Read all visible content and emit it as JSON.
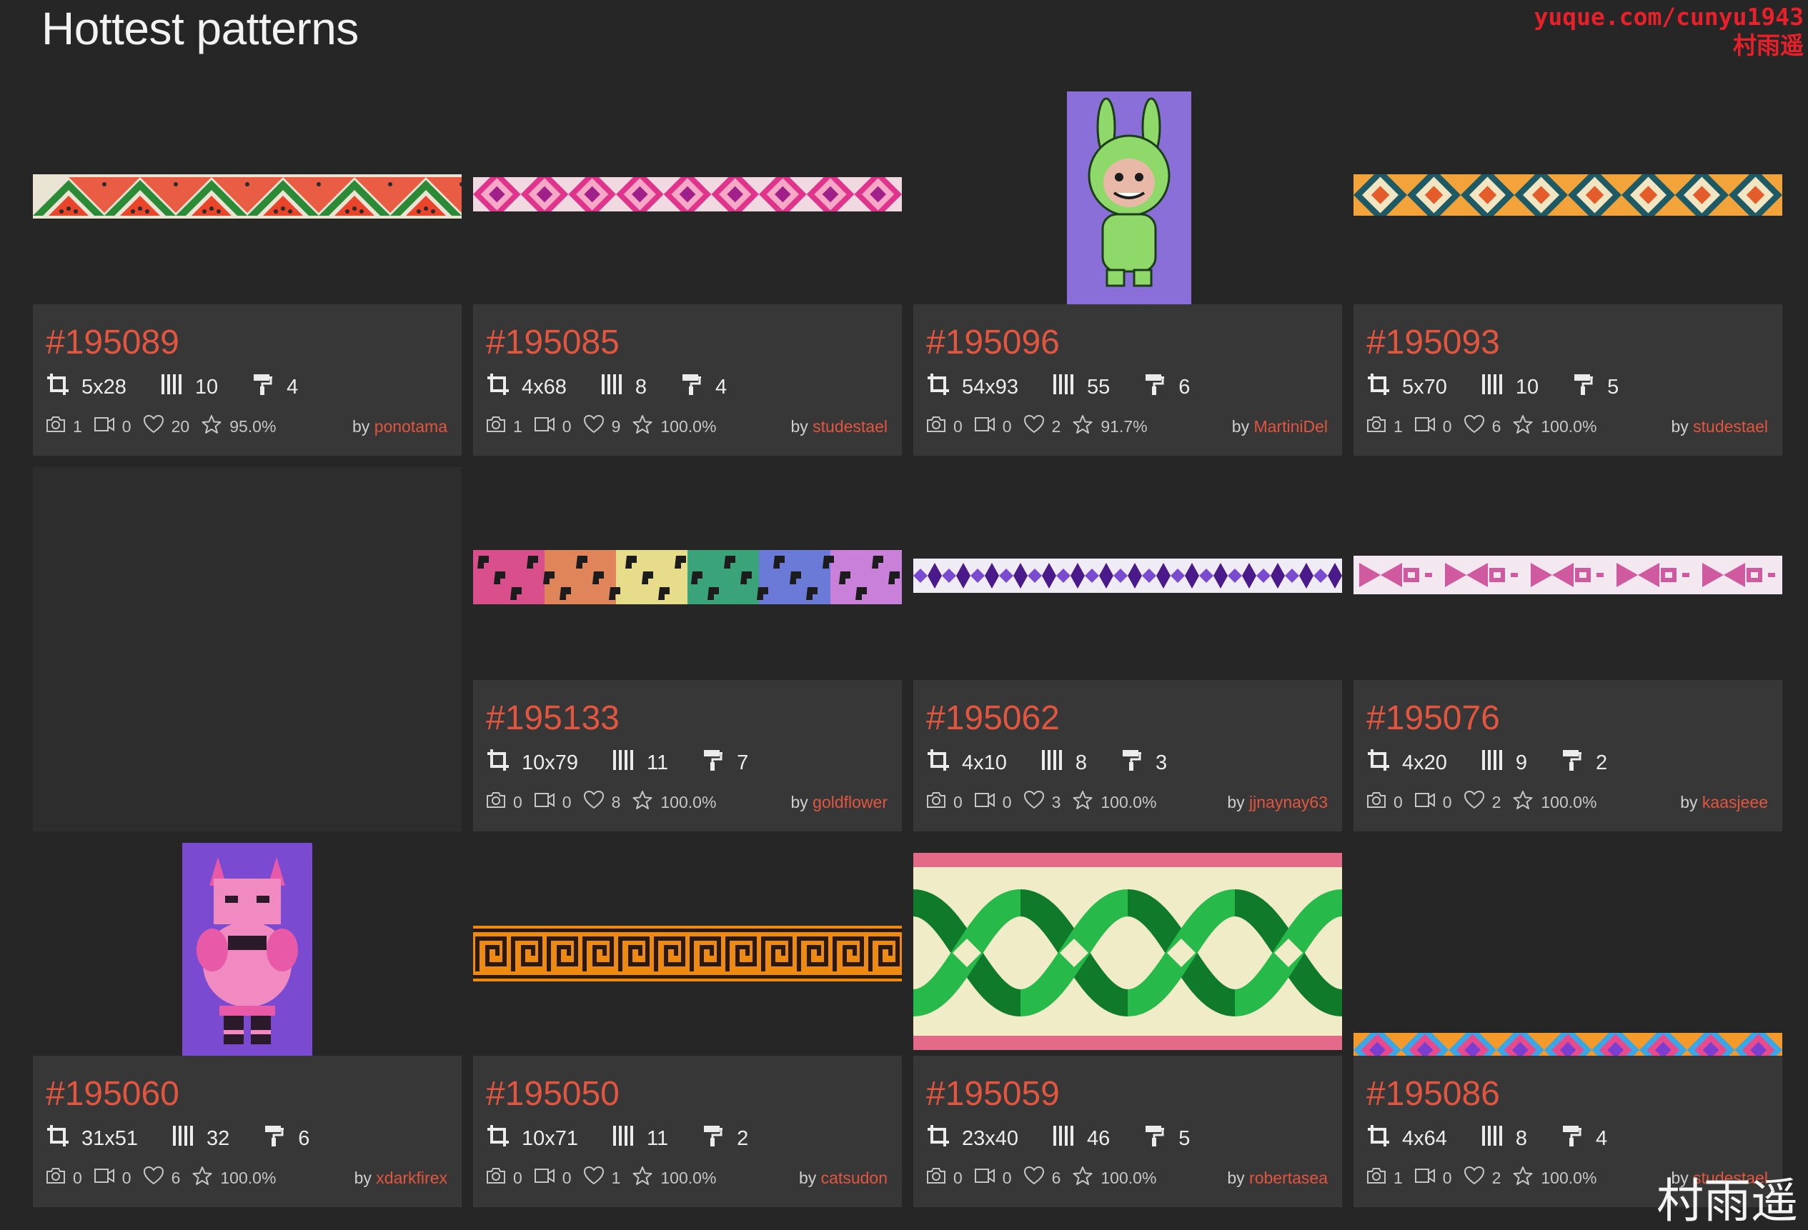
{
  "page": {
    "title": "Hottest patterns"
  },
  "watermark": {
    "line1": "yuque.com/cunyu1943",
    "line2": "村雨遥",
    "bottom": "村雨遥"
  },
  "colors": {
    "accent": "#e2553f",
    "background": "#262626",
    "card_info": "#373737"
  },
  "icons": {
    "size": "crop-icon",
    "columns": "columns-icon",
    "colors": "paint-roller-icon",
    "photos": "camera-icon",
    "videos": "video-icon",
    "likes": "heart-icon",
    "rating": "star-icon"
  },
  "cards": [
    {
      "id": "#195089",
      "size": "5x28",
      "columns": "10",
      "colors": "4",
      "photos": "1",
      "videos": "0",
      "likes": "20",
      "rating": "95.0%",
      "by": "by",
      "author": "ponotama",
      "pattern": "zigzag-watermelon"
    },
    {
      "id": "#195085",
      "size": "4x68",
      "columns": "8",
      "colors": "4",
      "photos": "1",
      "videos": "0",
      "likes": "9",
      "rating": "100.0%",
      "by": "by",
      "author": "studestael",
      "pattern": "diamond-pink"
    },
    {
      "id": "#195096",
      "size": "54x93",
      "columns": "55",
      "colors": "6",
      "photos": "0",
      "videos": "0",
      "likes": "2",
      "rating": "91.7%",
      "by": "by",
      "author": "MartiniDel",
      "pattern": "green-creature"
    },
    {
      "id": "#195093",
      "size": "5x70",
      "columns": "10",
      "colors": "5",
      "photos": "1",
      "videos": "0",
      "likes": "6",
      "rating": "100.0%",
      "by": "by",
      "author": "studestael",
      "pattern": "diamond-teal"
    },
    {
      "empty": true
    },
    {
      "id": "#195133",
      "size": "10x79",
      "columns": "11",
      "colors": "7",
      "photos": "0",
      "videos": "0",
      "likes": "8",
      "rating": "100.0%",
      "by": "by",
      "author": "goldflower",
      "pattern": "leopard"
    },
    {
      "id": "#195062",
      "size": "4x10",
      "columns": "8",
      "colors": "3",
      "photos": "0",
      "videos": "0",
      "likes": "3",
      "rating": "100.0%",
      "by": "by",
      "author": "jjnaynay63",
      "pattern": "purple-checker"
    },
    {
      "id": "#195076",
      "size": "4x20",
      "columns": "9",
      "colors": "2",
      "photos": "0",
      "videos": "0",
      "likes": "2",
      "rating": "100.0%",
      "by": "by",
      "author": "kaasjeee",
      "pattern": "pink-xo"
    },
    {
      "id": "#195060",
      "size": "31x51",
      "columns": "32",
      "colors": "6",
      "photos": "0",
      "videos": "0",
      "likes": "6",
      "rating": "100.0%",
      "by": "by",
      "author": "xdarkfirex",
      "pattern": "pink-creature"
    },
    {
      "id": "#195050",
      "size": "10x71",
      "columns": "11",
      "colors": "2",
      "photos": "0",
      "videos": "0",
      "likes": "1",
      "rating": "100.0%",
      "by": "by",
      "author": "catsudon",
      "pattern": "greek-key"
    },
    {
      "id": "#195059",
      "size": "23x40",
      "columns": "46",
      "colors": "5",
      "photos": "0",
      "videos": "0",
      "likes": "6",
      "rating": "100.0%",
      "by": "by",
      "author": "robertasea",
      "pattern": "celtic-braid"
    },
    {
      "id": "#195086",
      "size": "4x64",
      "columns": "8",
      "colors": "4",
      "photos": "1",
      "videos": "0",
      "likes": "2",
      "rating": "100.0%",
      "by": "by",
      "author": "studestael",
      "pattern": "diamond-blue"
    }
  ]
}
